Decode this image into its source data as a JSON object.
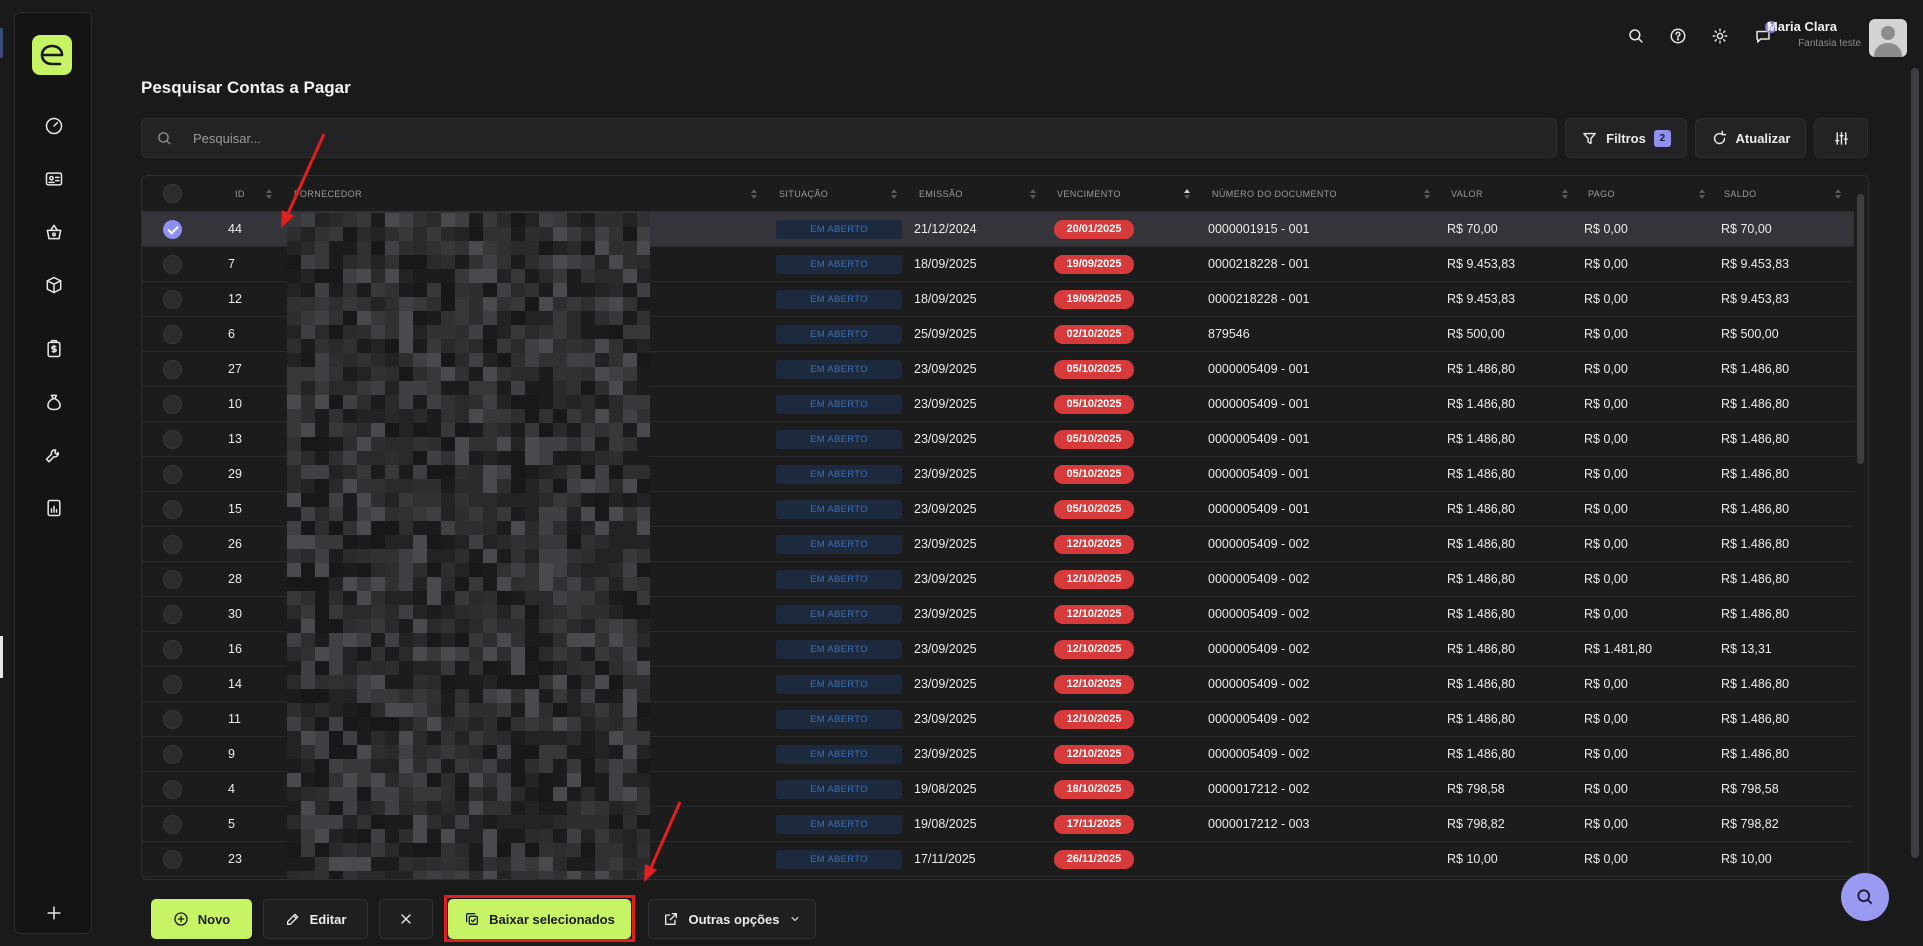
{
  "user": {
    "name": "Maria Clara",
    "company": "Fantasia teste",
    "notifications": "5"
  },
  "page": {
    "title": "Pesquisar Contas a Pagar"
  },
  "search": {
    "placeholder": "Pesquisar..."
  },
  "toolbar": {
    "filters_label": "Filtros",
    "filters_count": "2",
    "refresh_label": "Atualizar"
  },
  "table": {
    "columns": {
      "id": "ID",
      "supplier": "FORNECEDOR",
      "status": "SITUAÇÃO",
      "issue": "EMISSÃO",
      "due": "VENCIMENTO",
      "doc": "NÚMERO DO DOCUMENTO",
      "value": "VALOR",
      "paid": "PAGO",
      "balance": "SALDO"
    },
    "status_colors": {
      "open_bg": "#1d2a3d",
      "open_text": "#3a6fb8",
      "overdue_bg": "#d63a3a"
    },
    "rows": [
      {
        "id": "44",
        "status": "EM ABERTO",
        "issue": "21/12/2024",
        "due": "20/01/2025",
        "doc": "0000001915 - 001",
        "value": "R$ 70,00",
        "paid": "R$ 0,00",
        "balance": "R$ 70,00",
        "selected": true
      },
      {
        "id": "7",
        "status": "EM ABERTO",
        "issue": "18/09/2025",
        "due": "19/09/2025",
        "doc": "0000218228 - 001",
        "value": "R$ 9.453,83",
        "paid": "R$ 0,00",
        "balance": "R$ 9.453,83",
        "selected": false
      },
      {
        "id": "12",
        "status": "EM ABERTO",
        "issue": "18/09/2025",
        "due": "19/09/2025",
        "doc": "0000218228 - 001",
        "value": "R$ 9.453,83",
        "paid": "R$ 0,00",
        "balance": "R$ 9.453,83",
        "selected": false
      },
      {
        "id": "6",
        "status": "EM ABERTO",
        "issue": "25/09/2025",
        "due": "02/10/2025",
        "doc": "879546",
        "value": "R$ 500,00",
        "paid": "R$ 0,00",
        "balance": "R$ 500,00",
        "selected": false
      },
      {
        "id": "27",
        "status": "EM ABERTO",
        "issue": "23/09/2025",
        "due": "05/10/2025",
        "doc": "0000005409 - 001",
        "value": "R$ 1.486,80",
        "paid": "R$ 0,00",
        "balance": "R$ 1.486,80",
        "selected": false
      },
      {
        "id": "10",
        "status": "EM ABERTO",
        "issue": "23/09/2025",
        "due": "05/10/2025",
        "doc": "0000005409 - 001",
        "value": "R$ 1.486,80",
        "paid": "R$ 0,00",
        "balance": "R$ 1.486,80",
        "selected": false
      },
      {
        "id": "13",
        "status": "EM ABERTO",
        "issue": "23/09/2025",
        "due": "05/10/2025",
        "doc": "0000005409 - 001",
        "value": "R$ 1.486,80",
        "paid": "R$ 0,00",
        "balance": "R$ 1.486,80",
        "selected": false
      },
      {
        "id": "29",
        "status": "EM ABERTO",
        "issue": "23/09/2025",
        "due": "05/10/2025",
        "doc": "0000005409 - 001",
        "value": "R$ 1.486,80",
        "paid": "R$ 0,00",
        "balance": "R$ 1.486,80",
        "selected": false
      },
      {
        "id": "15",
        "status": "EM ABERTO",
        "issue": "23/09/2025",
        "due": "05/10/2025",
        "doc": "0000005409 - 001",
        "value": "R$ 1.486,80",
        "paid": "R$ 0,00",
        "balance": "R$ 1.486,80",
        "selected": false
      },
      {
        "id": "26",
        "status": "EM ABERTO",
        "issue": "23/09/2025",
        "due": "12/10/2025",
        "doc": "0000005409 - 002",
        "value": "R$ 1.486,80",
        "paid": "R$ 0,00",
        "balance": "R$ 1.486,80",
        "selected": false
      },
      {
        "id": "28",
        "status": "EM ABERTO",
        "issue": "23/09/2025",
        "due": "12/10/2025",
        "doc": "0000005409 - 002",
        "value": "R$ 1.486,80",
        "paid": "R$ 0,00",
        "balance": "R$ 1.486,80",
        "selected": false
      },
      {
        "id": "30",
        "status": "EM ABERTO",
        "issue": "23/09/2025",
        "due": "12/10/2025",
        "doc": "0000005409 - 002",
        "value": "R$ 1.486,80",
        "paid": "R$ 0,00",
        "balance": "R$ 1.486,80",
        "selected": false
      },
      {
        "id": "16",
        "status": "EM ABERTO",
        "issue": "23/09/2025",
        "due": "12/10/2025",
        "doc": "0000005409 - 002",
        "value": "R$ 1.486,80",
        "paid": "R$ 1.481,80",
        "balance": "R$ 13,31",
        "selected": false
      },
      {
        "id": "14",
        "status": "EM ABERTO",
        "issue": "23/09/2025",
        "due": "12/10/2025",
        "doc": "0000005409 - 002",
        "value": "R$ 1.486,80",
        "paid": "R$ 0,00",
        "balance": "R$ 1.486,80",
        "selected": false
      },
      {
        "id": "11",
        "status": "EM ABERTO",
        "issue": "23/09/2025",
        "due": "12/10/2025",
        "doc": "0000005409 - 002",
        "value": "R$ 1.486,80",
        "paid": "R$ 0,00",
        "balance": "R$ 1.486,80",
        "selected": false
      },
      {
        "id": "9",
        "status": "EM ABERTO",
        "issue": "23/09/2025",
        "due": "12/10/2025",
        "doc": "0000005409 - 002",
        "value": "R$ 1.486,80",
        "paid": "R$ 0,00",
        "balance": "R$ 1.486,80",
        "selected": false
      },
      {
        "id": "4",
        "status": "EM ABERTO",
        "issue": "19/08/2025",
        "due": "18/10/2025",
        "doc": "0000017212 - 002",
        "value": "R$ 798,58",
        "paid": "R$ 0,00",
        "balance": "R$ 798,58",
        "selected": false
      },
      {
        "id": "5",
        "status": "EM ABERTO",
        "issue": "19/08/2025",
        "due": "17/11/2025",
        "doc": "0000017212 - 003",
        "value": "R$ 798,82",
        "paid": "R$ 0,00",
        "balance": "R$ 798,82",
        "selected": false
      },
      {
        "id": "23",
        "status": "EM ABERTO",
        "issue": "17/11/2025",
        "due": "26/11/2025",
        "doc": "",
        "value": "R$ 10,00",
        "paid": "R$ 0,00",
        "balance": "R$ 10,00",
        "selected": false
      }
    ]
  },
  "actions": {
    "new_label": "Novo",
    "edit_label": "Editar",
    "pay_selected_label": "Baixar selecionados",
    "more_label": "Outras opções"
  },
  "colors": {
    "accent": "#c7f464",
    "purple": "#8e8ff0",
    "annotation": "#e02020"
  }
}
